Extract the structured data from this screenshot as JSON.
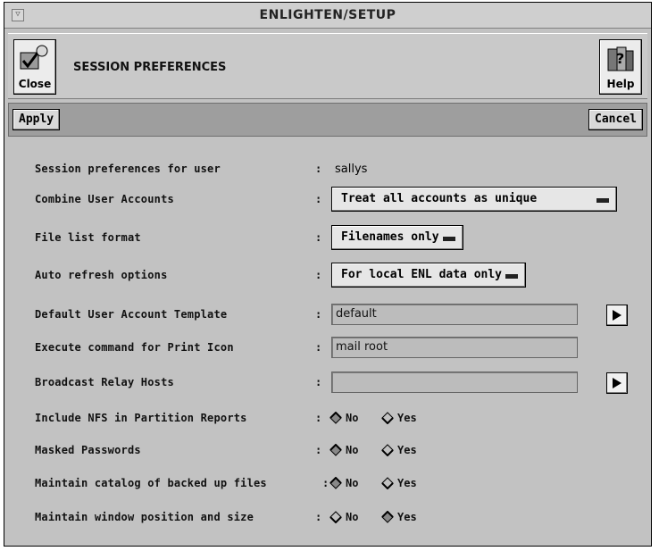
{
  "window": {
    "title": "ENLIGHTEN/SETUP",
    "menu_glyph": "▽"
  },
  "header": {
    "close_label": "Close",
    "help_label": "Help",
    "section_title": "SESSION PREFERENCES"
  },
  "toolbar": {
    "apply_label": "Apply",
    "cancel_label": "Cancel"
  },
  "form": {
    "colon": ":",
    "user": {
      "label": "Session preferences for user",
      "value": "sallys"
    },
    "combine": {
      "label": "Combine User Accounts",
      "selected": "Treat all accounts as unique"
    },
    "filelist": {
      "label": "File list format",
      "selected": "Filenames only"
    },
    "autorefresh": {
      "label": "Auto refresh options",
      "selected": "For local ENL data only"
    },
    "template": {
      "label": "Default User Account Template",
      "value": "default"
    },
    "printcmd": {
      "label": "Execute command for Print Icon",
      "value": "mail root"
    },
    "relay": {
      "label": "Broadcast Relay Hosts",
      "value": ""
    },
    "radio_no": "No",
    "radio_yes": "Yes",
    "nfs": {
      "label": "Include NFS in Partition Reports",
      "selected": "No"
    },
    "masked": {
      "label": "Masked Passwords",
      "selected": "No"
    },
    "catalog": {
      "label": "Maintain catalog of backed up files",
      "selected": "No"
    },
    "winpos": {
      "label": "Maintain window position and size",
      "selected": "Yes"
    }
  }
}
